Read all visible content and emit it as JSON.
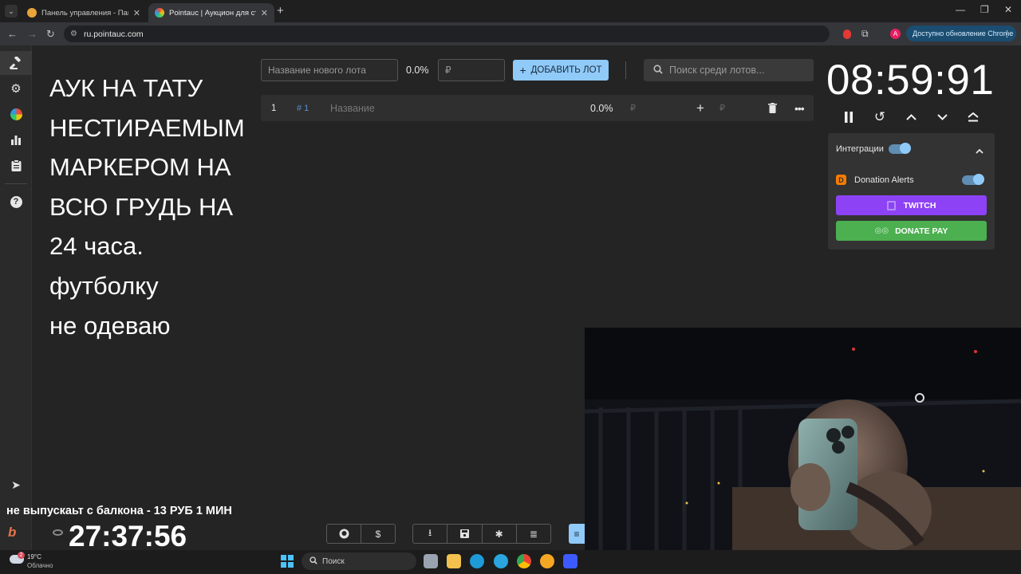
{
  "browser": {
    "tabs": [
      {
        "title": "Панель управления - Панель у"
      },
      {
        "title": "Pointauc | Аукцион для стрим"
      }
    ],
    "url": "ru.pointauc.com",
    "update_label": "Доступно обновление Chrome",
    "profile_letter": "A"
  },
  "overlay": {
    "lines": [
      "АУК НА ТАТУ",
      "НЕСТИРАЕМЫМ",
      "МАРКЕРОМ НА",
      "ВСЮ ГРУДЬ НА",
      "24 часа.",
      "футболку",
      "не одеваю"
    ]
  },
  "lot_form": {
    "name_placeholder": "Название нового лота",
    "percent": "0.0%",
    "currency": "₽",
    "add_label": "ДОБАВИТЬ ЛОТ",
    "search_placeholder": "Поиск среди лотов..."
  },
  "lot_row": {
    "index": "1",
    "id": "# 1",
    "name_placeholder": "Название",
    "percent": "0.0%",
    "currency": "₽",
    "add_currency": "₽"
  },
  "timer": {
    "value": "08:59:91"
  },
  "integrations": {
    "title": "Интеграции",
    "enabled": true,
    "donation_alerts_label": "Donation Alerts",
    "twitch_label": "TWITCH",
    "donatepay_label": "DONATE PAY"
  },
  "stream_overlay": {
    "ticker": "не выпускаьт с балкона - 13 РУБ 1 МИН",
    "uptime": "27:37:56"
  },
  "taskbar": {
    "weather_temp": "19°C",
    "weather_desc": "Облачно",
    "weather_badge": "2",
    "search_label": "Поиск"
  },
  "colors": {
    "accent": "#90caf9",
    "twitch": "#8d42f5",
    "donatepay": "#4caf50"
  }
}
